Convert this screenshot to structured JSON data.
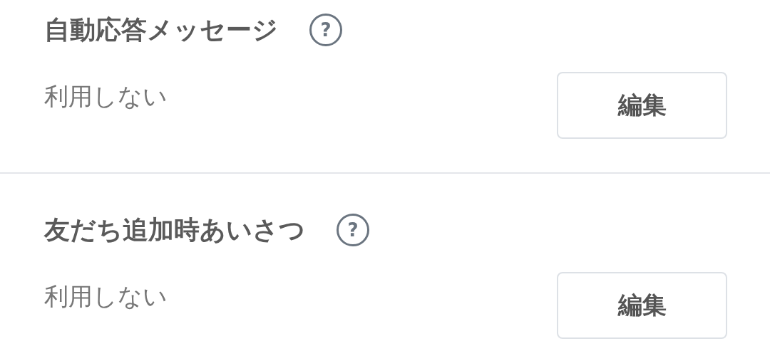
{
  "settings": [
    {
      "title": "自動応答メッセージ",
      "help": "?",
      "value": "利用しない",
      "button": "編集"
    },
    {
      "title": "友だち追加時あいさつ",
      "help": "?",
      "value": "利用しない",
      "button": "編集"
    }
  ]
}
